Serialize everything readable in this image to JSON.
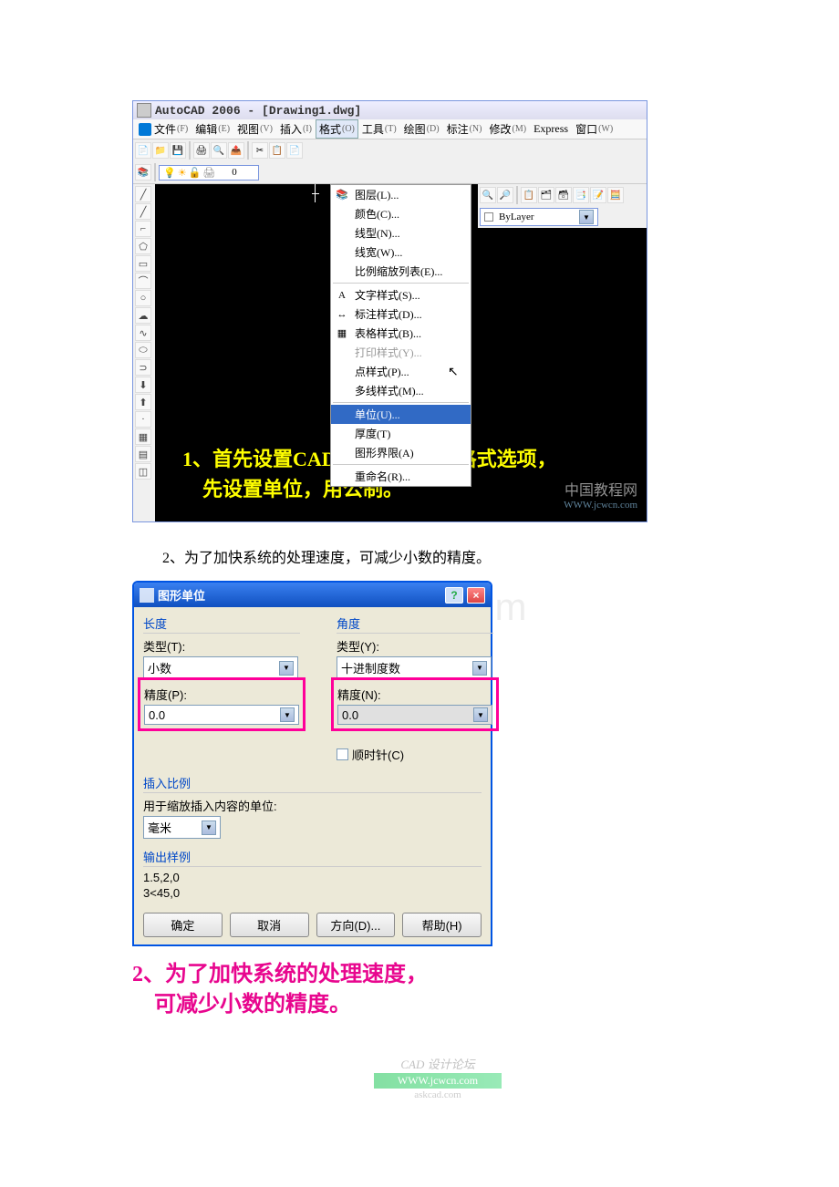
{
  "acad": {
    "title": "AutoCAD 2006 - [Drawing1.dwg]",
    "menubar": [
      {
        "label": "文件",
        "u": "(F)"
      },
      {
        "label": "编辑",
        "u": "(E)"
      },
      {
        "label": "视图",
        "u": "(V)"
      },
      {
        "label": "插入",
        "u": "(I)"
      },
      {
        "label": "格式",
        "u": "(O)",
        "highlighted": true
      },
      {
        "label": "工具",
        "u": "(T)"
      },
      {
        "label": "绘图",
        "u": "(D)"
      },
      {
        "label": "标注",
        "u": "(N)"
      },
      {
        "label": "修改",
        "u": "(M)"
      },
      {
        "label": "Express",
        "u": ""
      },
      {
        "label": "窗口",
        "u": "(W)"
      }
    ],
    "layer_combo": "0",
    "bylayer": "ByLayer",
    "dropdown": [
      {
        "label": "图层(L)...",
        "icon": "📚"
      },
      {
        "label": "颜色(C)..."
      },
      {
        "label": "线型(N)..."
      },
      {
        "label": "线宽(W)..."
      },
      {
        "label": "比例缩放列表(E)..."
      },
      {
        "sep": true
      },
      {
        "label": "文字样式(S)...",
        "icon": "A"
      },
      {
        "label": "标注样式(D)...",
        "icon": "↔"
      },
      {
        "label": "表格样式(B)...",
        "icon": "▦"
      },
      {
        "label": "打印样式(Y)...",
        "disabled": true
      },
      {
        "label": "点样式(P)..."
      },
      {
        "label": "多线样式(M)..."
      },
      {
        "sep": true
      },
      {
        "label": "单位(U)...",
        "highlighted": true
      },
      {
        "label": "厚度(T)"
      },
      {
        "label": "图形界限(A)"
      },
      {
        "sep": true
      },
      {
        "label": "重命名(R)..."
      }
    ],
    "yellow_annotation": "1、首先设置CAD2006菜单下的格式选项，\n    先设置单位，用公制。",
    "watermark": {
      "big": "中国教程网",
      "small": "WWW.jcwcn.com"
    }
  },
  "caption_2": "2、为了加快系统的处理速度，可减少小数的精度。",
  "units": {
    "title": "图形单位",
    "watermark_bd": "www.bdocx.com",
    "length": {
      "header": "长度",
      "type_label": "类型(T):",
      "type_value": "小数",
      "precision_label": "精度(P):",
      "precision_value": "0.0"
    },
    "angle": {
      "header": "角度",
      "type_label": "类型(Y):",
      "type_value": "十进制度数",
      "precision_label": "精度(N):",
      "precision_value": "0.0",
      "clockwise": "顺时针(C)"
    },
    "insert": {
      "header": "插入比例",
      "label": "用于缩放插入内容的单位:",
      "value": "毫米"
    },
    "output": {
      "header": "输出样例",
      "line1": "1.5,2,0",
      "line2": "3<45,0"
    },
    "buttons": {
      "ok": "确定",
      "cancel": "取消",
      "direction": "方向(D)...",
      "help": "帮助(H)"
    }
  },
  "pink_caption": "2、为了加快系统的处理速度，\n    可减少小数的精度。",
  "bottom_logo": {
    "name": "CAD 设计论坛",
    "url": "WWW.jcwcn.com",
    "sub": "askcad.com"
  }
}
